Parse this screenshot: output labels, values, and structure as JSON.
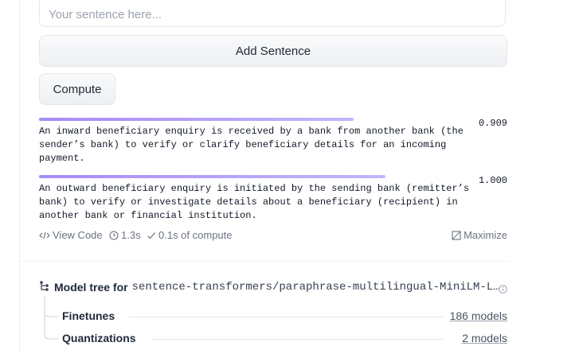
{
  "input": {
    "placeholder": "Your sentence here..."
  },
  "buttons": {
    "add_sentence": "Add Sentence",
    "compute": "Compute"
  },
  "results": [
    {
      "score": "0.909",
      "similarity": 0.909,
      "sentence": "An inward beneficiary enquiry is received by a bank from another bank (the sender’s bank) to verify or clarify beneficiary details for an incoming payment."
    },
    {
      "score": "1.000",
      "similarity": 1.0,
      "sentence": "An outward beneficiary enquiry is initiated by the sending bank (remitter’s bank) to verify or investigate details about a beneficiary (recipient) in another bank or financial institution."
    }
  ],
  "meta": {
    "view_code": "View Code",
    "time": "1.3s",
    "compute": "0.1s of compute",
    "maximize": "Maximize"
  },
  "model_tree": {
    "label": "Model tree for",
    "model": "sentence-transformers/paraphrase-multilingual-MiniLM-L…",
    "rows": [
      {
        "name": "Finetunes",
        "count": "186 models"
      },
      {
        "name": "Quantizations",
        "count": "2 models"
      }
    ]
  }
}
